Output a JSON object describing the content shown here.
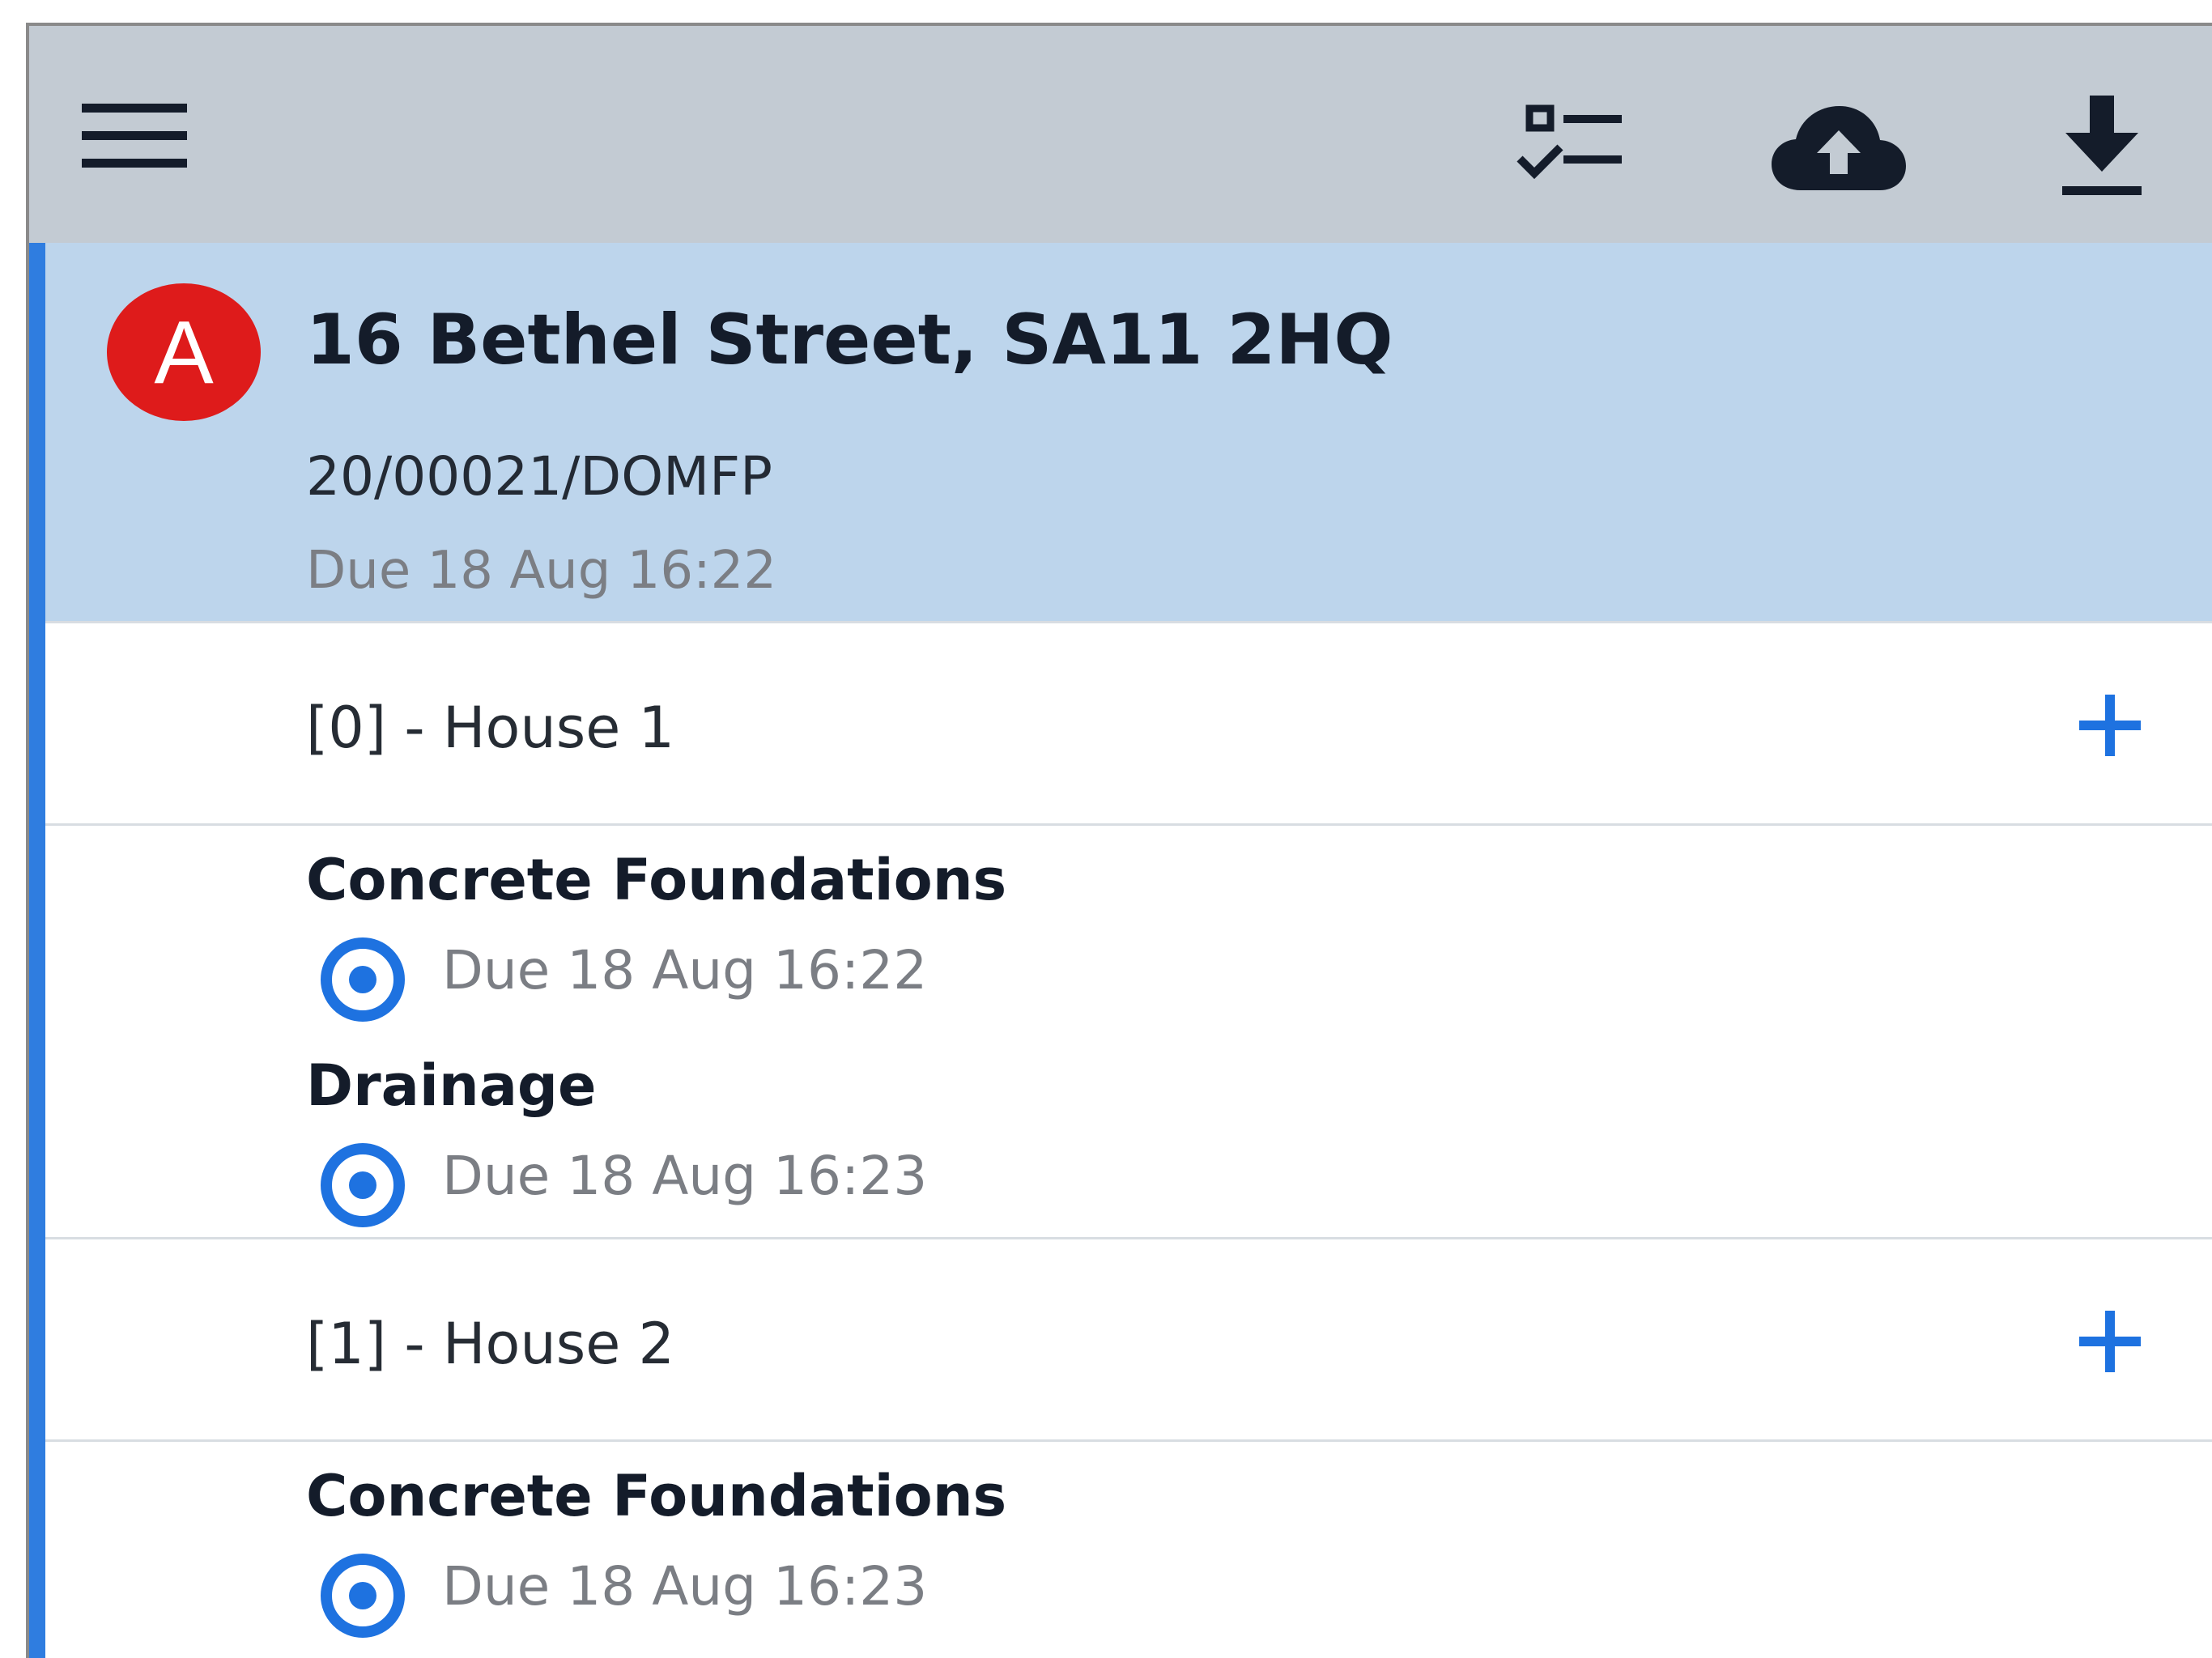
{
  "toolbar": {
    "icons": [
      "menu-icon",
      "checklist-icon",
      "cloud-upload-icon",
      "download-icon"
    ]
  },
  "colors": {
    "toolbar_bg": "#c3cbd3",
    "header_bg": "#bdd5ec",
    "accent_blue": "#1e72e0",
    "avatar_red": "#de1b1b"
  },
  "inspection": {
    "avatar_letter": "A",
    "address": "16 Bethel Street, SA11 2HQ",
    "reference": "20/00021/DOMFP",
    "due": "Due 18 Aug 16:22"
  },
  "groups": [
    {
      "label": "[0] - House 1",
      "items": [
        {
          "title": "Concrete Foundations",
          "due": "Due 18 Aug 16:22",
          "status_icon": "target-icon"
        },
        {
          "title": "Drainage",
          "due": "Due 18 Aug 16:23",
          "status_icon": "target-icon"
        }
      ]
    },
    {
      "label": "[1] - House 2",
      "items": [
        {
          "title": "Concrete Foundations",
          "due": "Due 18 Aug 16:23",
          "status_icon": "target-icon"
        }
      ]
    }
  ]
}
